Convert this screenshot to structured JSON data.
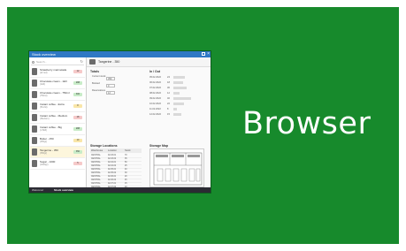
{
  "tile": {
    "label": "Browser"
  },
  "window": {
    "title": "Stock overview",
    "close_glyph": "×",
    "search_placeholder": "Search...",
    "refresh_glyph": "↻",
    "items": [
      {
        "name": "Strawberry marmelade",
        "sub": "(all red)",
        "badge": "12",
        "badge_color": "#f6c9c9"
      },
      {
        "name": "Chocolate cream - 1kill",
        "sub": "(1kill)",
        "badge": "288",
        "badge_color": "#c8ecc8"
      },
      {
        "name": "Chocolate cream - 750ml",
        "sub": "(750ml)",
        "badge": "300",
        "badge_color": "#c8ecc8"
      },
      {
        "name": "Instant coffee - Extra",
        "sub": "(50.2kt)",
        "badge": "8",
        "badge_color": "#f9e6a8"
      },
      {
        "name": "Instant coffee - Medium",
        "sub": "(Medium)",
        "badge": "18",
        "badge_color": "#f6c9c9"
      },
      {
        "name": "Instant coffee - Big",
        "sub": "(1.5kill)",
        "badge": "288",
        "badge_color": "#c8ecc8"
      },
      {
        "name": "Butter - 250",
        "sub": "(250gr)",
        "badge": "10",
        "badge_color": "#f9e6a8"
      },
      {
        "name": "Tangerine - 350",
        "sub": "(350gr)",
        "badge": "350",
        "badge_color": "#c8ecc8"
      },
      {
        "name": "Sugar - 1000",
        "sub": "(1000gr)",
        "badge": "5",
        "badge_color": "#f6c9c9"
      }
    ],
    "detail": {
      "header": "Tangerine - 350",
      "totals_title": "Totals",
      "in_out_title": "In / Out",
      "storage_title": "Storage Locations",
      "map_title": "Storage Map",
      "totals_labels": [
        "Current stock",
        "Booked",
        "Reservations"
      ],
      "totals_values": [
        "350",
        "0",
        "12"
      ],
      "dates": [
        "05.02.2022",
        "06.02.2022",
        "07.02.2022",
        "08.02.2022",
        "09.02.2022",
        "10.02.2022",
        "11.02.2022",
        "12.02.2022"
      ],
      "qty": [
        "24",
        "18",
        "30",
        "12",
        "40",
        "22",
        "8",
        "15"
      ],
      "io_levels": [
        0.6,
        0.5,
        0.7,
        0.3,
        0.9,
        0.55,
        0.2,
        0.4
      ],
      "table_headers": [
        "Warehouse",
        "Location",
        "Stock"
      ],
      "table_rows": [
        [
          "CENTRAL",
          "02-03-01",
          "70"
        ],
        [
          "CENTRAL",
          "02-03-02",
          "35"
        ],
        [
          "CENTRAL",
          "02-04-01",
          "50"
        ],
        [
          "CENTRAL",
          "02-04-02",
          "25"
        ],
        [
          "CENTRAL",
          "02-05-01",
          "40"
        ],
        [
          "CENTRAL",
          "02-05-02",
          "30"
        ],
        [
          "CENTRAL",
          "02-06-01",
          "20"
        ],
        [
          "CENTRAL",
          "02-06-02",
          "45"
        ],
        [
          "CENTRAL",
          "02-07-01",
          "15"
        ],
        [
          "CENTRAL",
          "02-07-02",
          "10"
        ]
      ]
    },
    "status": {
      "left": "Welcome!",
      "tab": "Stock overview"
    }
  }
}
